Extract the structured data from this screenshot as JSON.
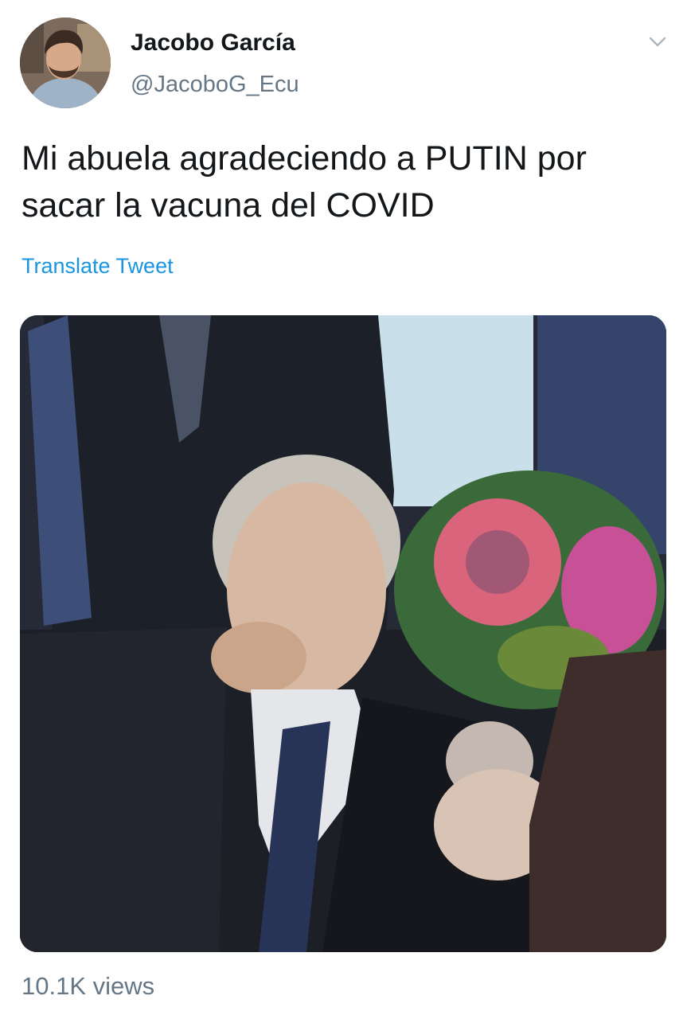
{
  "tweet": {
    "author": {
      "display_name": "Jacobo García",
      "handle": "@JacoboG_Ecu",
      "avatar_icon": "profile-photo"
    },
    "more_icon": "chevron-down-icon",
    "text": "Mi abuela agradeciendo a PUTIN por sacar la vacuna del COVID",
    "translate_label": "Translate Tweet",
    "media": {
      "kind": "video"
    },
    "views": "10.1K views"
  },
  "colors": {
    "text_primary": "#14171a",
    "text_secondary": "#657786",
    "link": "#1b95e0",
    "chevron": "#aab8c2"
  }
}
